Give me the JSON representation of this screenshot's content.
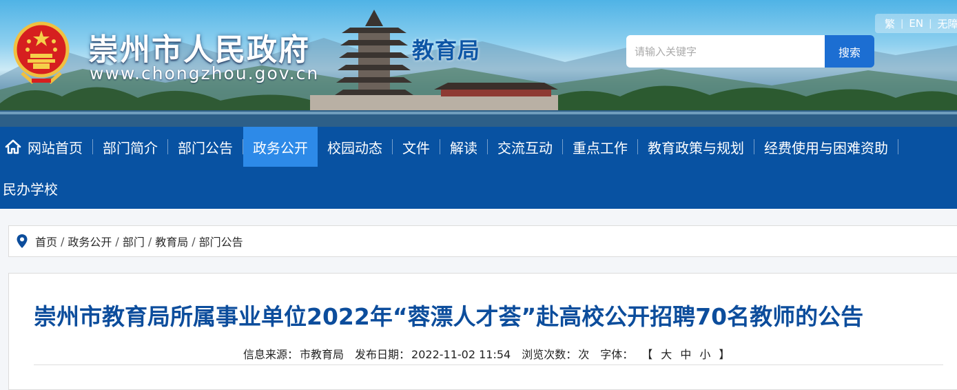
{
  "header": {
    "site_name": "崇州市人民政府",
    "site_url": "www.chongzhou.gov.cn",
    "department": "教育局",
    "util_links": [
      "繁",
      "EN",
      "无障"
    ],
    "search": {
      "placeholder": "请输入关键字",
      "button_label": "搜索"
    },
    "emblem_icon": "national-emblem-icon"
  },
  "nav": {
    "row1": [
      {
        "label": "网站首页",
        "icon": "home-icon",
        "active": false
      },
      {
        "label": "部门简介",
        "active": false
      },
      {
        "label": "部门公告",
        "active": false
      },
      {
        "label": "政务公开",
        "active": true
      },
      {
        "label": "校园动态",
        "active": false
      },
      {
        "label": "文件",
        "active": false
      },
      {
        "label": "解读",
        "active": false
      },
      {
        "label": "交流互动",
        "active": false
      },
      {
        "label": "重点工作",
        "active": false
      },
      {
        "label": "教育政策与规划",
        "active": false
      },
      {
        "label": "经费使用与困难资助",
        "active": false
      }
    ],
    "row2": [
      {
        "label": "民办学校",
        "active": false
      }
    ],
    "colors": {
      "bar": "#0852a2",
      "active": "#2d8ae8"
    }
  },
  "breadcrumb": {
    "icon": "location-pin-icon",
    "items": [
      "首页",
      "政务公开",
      "部门",
      "教育局",
      "部门公告"
    ],
    "separator": "/"
  },
  "article": {
    "title": "崇州市教育局所属事业单位2022年“蓉漂人才荟”赴高校公开招聘70名教师的公告",
    "meta": {
      "source_label": "信息来源：",
      "source": "市教育局",
      "date_label": "发布日期：",
      "date": "2022-11-02 11:54",
      "views_label": "浏览次数：",
      "views_unit": "次",
      "font_label": "字体：",
      "bracket_open": "【",
      "font_sizes": [
        "大",
        "中",
        "小"
      ],
      "bracket_close": "】"
    },
    "title_color": "#0c4d9c"
  }
}
